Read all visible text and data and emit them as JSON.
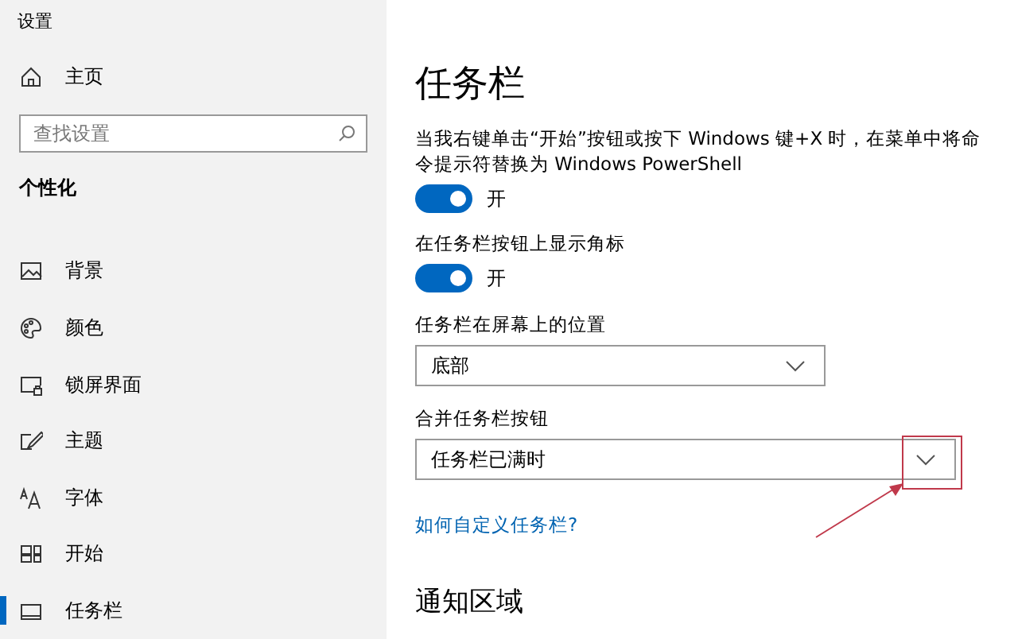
{
  "window": {
    "title": "设置"
  },
  "sidebar": {
    "home": "主页",
    "search": {
      "placeholder": "查找设置"
    },
    "section": "个性化",
    "items": [
      {
        "label": "背景",
        "selected": false
      },
      {
        "label": "颜色",
        "selected": false
      },
      {
        "label": "锁屏界面",
        "selected": false
      },
      {
        "label": "主题",
        "selected": false
      },
      {
        "label": "字体",
        "selected": false
      },
      {
        "label": "开始",
        "selected": false
      },
      {
        "label": "任务栏",
        "selected": true
      }
    ]
  },
  "page": {
    "title": "任务栏",
    "settings": [
      {
        "kind": "toggle",
        "label": "当我右键单击“开始”按钮或按下 Windows 键+X 时，在菜单中将命令提示符替换为 Windows PowerShell",
        "on": true,
        "state": "开"
      },
      {
        "kind": "toggle",
        "label": "在任务栏按钮上显示角标",
        "on": true,
        "state": "开"
      },
      {
        "kind": "dropdown",
        "label": "任务栏在屏幕上的位置",
        "value": "底部"
      },
      {
        "kind": "dropdown",
        "label": "合并任务栏按钮",
        "value": "任务栏已满时",
        "highlighted": true
      },
      {
        "kind": "link",
        "label": "如何自定义任务栏?"
      },
      {
        "kind": "heading",
        "label": "通知区域"
      }
    ]
  }
}
